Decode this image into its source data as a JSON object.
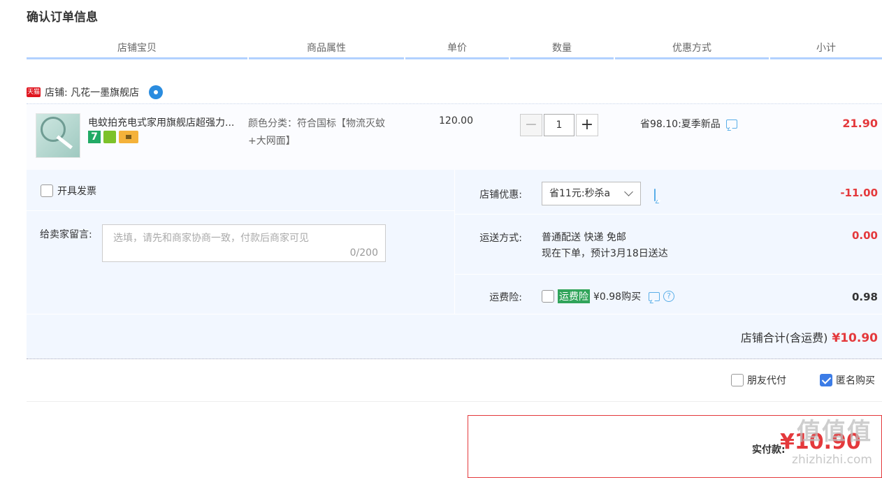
{
  "section_title": "确认订单信息",
  "table_headers": [
    "店铺宝贝",
    "商品属性",
    "单价",
    "数量",
    "优惠方式",
    "小计"
  ],
  "shop": {
    "badge": "天猫",
    "label": "店铺: 凡花一墨旗舰店"
  },
  "item": {
    "title": "电蚊拍充电式家用旗舰店超强力...",
    "attr_line1": "颜色分类：符合国标【物流灭蚊",
    "attr_line2": "+大网面】",
    "price": "120.00",
    "qty_minus": "−",
    "qty": "1",
    "qty_plus": "+",
    "badge_7": "7",
    "promo": "省98.10:夏季新品",
    "subtotal": "21.90"
  },
  "invoice_label": "开具发票",
  "message": {
    "label": "给卖家留言:",
    "placeholder": "选填，请先和商家协商一致，付款后商家可见",
    "counter": "0/200"
  },
  "shop_discount": {
    "label": "店铺优惠:",
    "selected": "省11元:秒杀a",
    "value": "-11.00"
  },
  "shipping": {
    "label": "运送方式:",
    "line1": "普通配送 快递 免邮",
    "line2": "现在下单，预计3月18日送达",
    "value": "0.00"
  },
  "insurance": {
    "label": "运费险:",
    "tag": "运费险",
    "text": "¥0.98购买",
    "value": "0.98",
    "help": "?"
  },
  "shop_total": {
    "label": "店铺合计(含运费)",
    "value": "¥10.90"
  },
  "options": {
    "friend_pay": "朋友代付",
    "anonymous": "匿名购买",
    "anonymous_checked": true
  },
  "payment": {
    "label": "实付款:",
    "amount": "¥10.90"
  },
  "watermark": {
    "main": "值值值",
    "sub": "zhizhizhi.com"
  },
  "colors": {
    "price_red": "#e4393c",
    "header_line": "#b2d1ff",
    "panel_bg": "#f2f7ff",
    "checkbox_blue": "#3c7ce6"
  }
}
